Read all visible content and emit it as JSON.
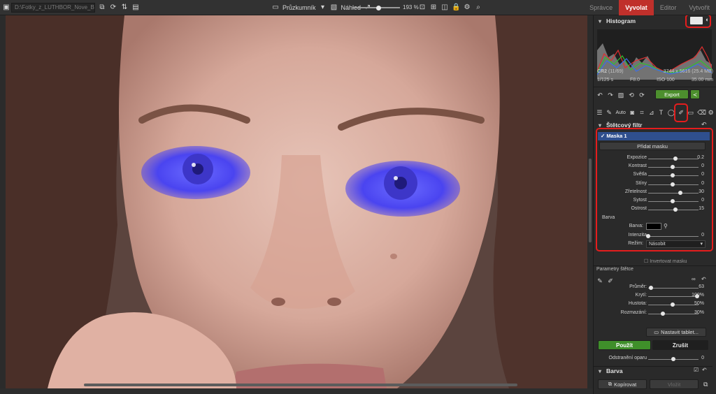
{
  "toolbar": {
    "path": "D:\\Fotky_z_LUTHBOR_Nove_Barbie",
    "browser_label": "Průzkumník",
    "preview_label": "Náhled",
    "zoom": "193 %",
    "zoom_level": 0.55
  },
  "modes": {
    "spravce": "Správce",
    "vyvolat": "Vyvolat",
    "editor": "Editor",
    "vytvorit": "Vytvořit"
  },
  "histogram": {
    "title": "Histogram"
  },
  "fileinfo": {
    "format": "CR2",
    "index": "(11/69)",
    "dimensions": "3744 x 5616 (25.4 MB)",
    "shutter": "1/125 s",
    "aperture": "F8.0",
    "iso": "ISO 100",
    "focal": "35.00 mm"
  },
  "actions": {
    "export": "Export"
  },
  "tools": {
    "auto": "Auto"
  },
  "brush_filter": {
    "title": "Štětcový filtr",
    "mask_name": "Maska 1",
    "add_mask": "Přidat masku",
    "sliders": [
      {
        "label": "Expozice",
        "value": "0.2",
        "level": 0.55
      },
      {
        "label": "Kontrast",
        "value": "0",
        "level": 0.5
      },
      {
        "label": "Světla",
        "value": "0",
        "level": 0.5
      },
      {
        "label": "Stíny",
        "value": "0",
        "level": 0.5
      },
      {
        "label": "Zřetelnost",
        "value": "30",
        "level": 0.65
      },
      {
        "label": "Sytost",
        "value": "0",
        "level": 0.5
      },
      {
        "label": "Ostrost",
        "value": "15",
        "level": 0.55
      }
    ],
    "color_section": "Barva",
    "color_label": "Barva:",
    "intensity_label": "Intenzita",
    "intensity_value": "0",
    "intensity_level": 0.0,
    "mode_label": "Režim:",
    "mode_value": "Násobit",
    "invert_label": "Invertovat masku"
  },
  "brush_params": {
    "title": "Parametry štětce",
    "sliders": [
      {
        "label": "Průměr:",
        "value": "63",
        "level": 0.05
      },
      {
        "label": "Krytí:",
        "value": "100%",
        "level": 1.0
      },
      {
        "label": "Hustota:",
        "value": "50%",
        "level": 0.5
      },
      {
        "label": "Rozmazání:",
        "value": "30%",
        "level": 0.3
      }
    ],
    "tablet_button": "Nastavit tablet..."
  },
  "apply": {
    "apply": "Použít",
    "cancel": "Zrušit"
  },
  "below": {
    "dehaze_label": "Odstranění oparu",
    "dehaze_value": "0"
  },
  "barva_section": "Barva",
  "bottom": {
    "copy": "Kopírovat",
    "paste": "Vložit"
  },
  "colors": {
    "accent_red": "#c0302b",
    "mask_blue": "#3c3cff",
    "mask_header_blue": "#2f4f8e",
    "apply_green": "#3f8f2a"
  }
}
